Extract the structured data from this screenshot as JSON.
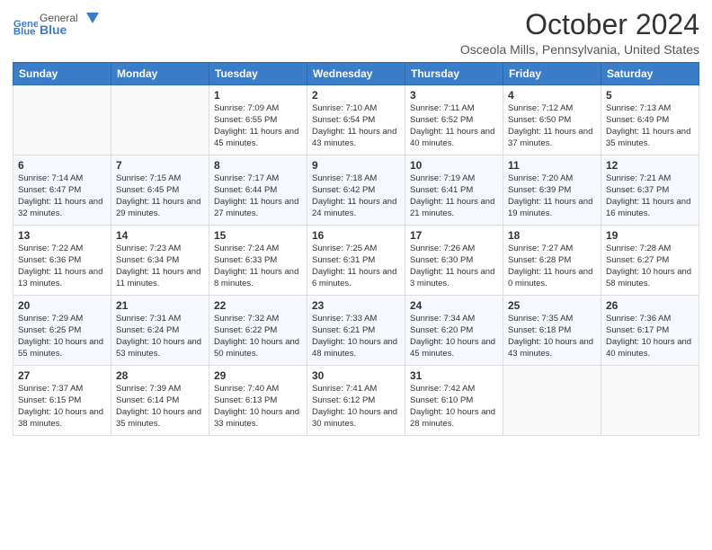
{
  "header": {
    "logo": {
      "general": "General",
      "blue": "Blue"
    },
    "title": "October 2024",
    "location": "Osceola Mills, Pennsylvania, United States"
  },
  "days_of_week": [
    "Sunday",
    "Monday",
    "Tuesday",
    "Wednesday",
    "Thursday",
    "Friday",
    "Saturday"
  ],
  "weeks": [
    [
      null,
      null,
      {
        "day": 1,
        "sunrise": "7:09 AM",
        "sunset": "6:55 PM",
        "daylight": "11 hours and 45 minutes."
      },
      {
        "day": 2,
        "sunrise": "7:10 AM",
        "sunset": "6:54 PM",
        "daylight": "11 hours and 43 minutes."
      },
      {
        "day": 3,
        "sunrise": "7:11 AM",
        "sunset": "6:52 PM",
        "daylight": "11 hours and 40 minutes."
      },
      {
        "day": 4,
        "sunrise": "7:12 AM",
        "sunset": "6:50 PM",
        "daylight": "11 hours and 37 minutes."
      },
      {
        "day": 5,
        "sunrise": "7:13 AM",
        "sunset": "6:49 PM",
        "daylight": "11 hours and 35 minutes."
      }
    ],
    [
      {
        "day": 6,
        "sunrise": "7:14 AM",
        "sunset": "6:47 PM",
        "daylight": "11 hours and 32 minutes."
      },
      {
        "day": 7,
        "sunrise": "7:15 AM",
        "sunset": "6:45 PM",
        "daylight": "11 hours and 29 minutes."
      },
      {
        "day": 8,
        "sunrise": "7:17 AM",
        "sunset": "6:44 PM",
        "daylight": "11 hours and 27 minutes."
      },
      {
        "day": 9,
        "sunrise": "7:18 AM",
        "sunset": "6:42 PM",
        "daylight": "11 hours and 24 minutes."
      },
      {
        "day": 10,
        "sunrise": "7:19 AM",
        "sunset": "6:41 PM",
        "daylight": "11 hours and 21 minutes."
      },
      {
        "day": 11,
        "sunrise": "7:20 AM",
        "sunset": "6:39 PM",
        "daylight": "11 hours and 19 minutes."
      },
      {
        "day": 12,
        "sunrise": "7:21 AM",
        "sunset": "6:37 PM",
        "daylight": "11 hours and 16 minutes."
      }
    ],
    [
      {
        "day": 13,
        "sunrise": "7:22 AM",
        "sunset": "6:36 PM",
        "daylight": "11 hours and 13 minutes."
      },
      {
        "day": 14,
        "sunrise": "7:23 AM",
        "sunset": "6:34 PM",
        "daylight": "11 hours and 11 minutes."
      },
      {
        "day": 15,
        "sunrise": "7:24 AM",
        "sunset": "6:33 PM",
        "daylight": "11 hours and 8 minutes."
      },
      {
        "day": 16,
        "sunrise": "7:25 AM",
        "sunset": "6:31 PM",
        "daylight": "11 hours and 6 minutes."
      },
      {
        "day": 17,
        "sunrise": "7:26 AM",
        "sunset": "6:30 PM",
        "daylight": "11 hours and 3 minutes."
      },
      {
        "day": 18,
        "sunrise": "7:27 AM",
        "sunset": "6:28 PM",
        "daylight": "11 hours and 0 minutes."
      },
      {
        "day": 19,
        "sunrise": "7:28 AM",
        "sunset": "6:27 PM",
        "daylight": "10 hours and 58 minutes."
      }
    ],
    [
      {
        "day": 20,
        "sunrise": "7:29 AM",
        "sunset": "6:25 PM",
        "daylight": "10 hours and 55 minutes."
      },
      {
        "day": 21,
        "sunrise": "7:31 AM",
        "sunset": "6:24 PM",
        "daylight": "10 hours and 53 minutes."
      },
      {
        "day": 22,
        "sunrise": "7:32 AM",
        "sunset": "6:22 PM",
        "daylight": "10 hours and 50 minutes."
      },
      {
        "day": 23,
        "sunrise": "7:33 AM",
        "sunset": "6:21 PM",
        "daylight": "10 hours and 48 minutes."
      },
      {
        "day": 24,
        "sunrise": "7:34 AM",
        "sunset": "6:20 PM",
        "daylight": "10 hours and 45 minutes."
      },
      {
        "day": 25,
        "sunrise": "7:35 AM",
        "sunset": "6:18 PM",
        "daylight": "10 hours and 43 minutes."
      },
      {
        "day": 26,
        "sunrise": "7:36 AM",
        "sunset": "6:17 PM",
        "daylight": "10 hours and 40 minutes."
      }
    ],
    [
      {
        "day": 27,
        "sunrise": "7:37 AM",
        "sunset": "6:15 PM",
        "daylight": "10 hours and 38 minutes."
      },
      {
        "day": 28,
        "sunrise": "7:39 AM",
        "sunset": "6:14 PM",
        "daylight": "10 hours and 35 minutes."
      },
      {
        "day": 29,
        "sunrise": "7:40 AM",
        "sunset": "6:13 PM",
        "daylight": "10 hours and 33 minutes."
      },
      {
        "day": 30,
        "sunrise": "7:41 AM",
        "sunset": "6:12 PM",
        "daylight": "10 hours and 30 minutes."
      },
      {
        "day": 31,
        "sunrise": "7:42 AM",
        "sunset": "6:10 PM",
        "daylight": "10 hours and 28 minutes."
      },
      null,
      null
    ]
  ],
  "labels": {
    "sunrise": "Sunrise:",
    "sunset": "Sunset:",
    "daylight": "Daylight:"
  }
}
